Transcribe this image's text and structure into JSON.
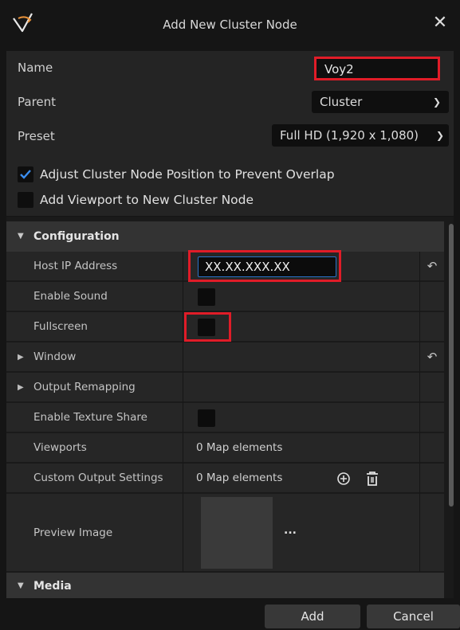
{
  "window": {
    "title": "Add New Cluster Node",
    "close_icon": "close-icon",
    "logo_icon": "app-logo-icon"
  },
  "form": {
    "name_label": "Name",
    "name_value": "Voy2",
    "parent_label": "Parent",
    "parent_value": "Cluster",
    "preset_label": "Preset",
    "preset_value": "Full HD (1,920 x 1,080)",
    "adjust_position": {
      "label": "Adjust Cluster Node Position to Prevent Overlap",
      "checked": true
    },
    "add_viewport": {
      "label": "Add Viewport to New Cluster Node",
      "checked": false
    }
  },
  "details": {
    "configuration_label": "Configuration",
    "host_ip_label": "Host IP Address",
    "host_ip_value": "XX.XX.XXX.XX",
    "enable_sound_label": "Enable Sound",
    "enable_sound_checked": false,
    "fullscreen_label": "Fullscreen",
    "fullscreen_checked": false,
    "window_label": "Window",
    "output_remapping_label": "Output Remapping",
    "enable_texture_share_label": "Enable Texture Share",
    "enable_texture_share_checked": false,
    "viewports_label": "Viewports",
    "viewports_value": "0 Map elements",
    "custom_output_label": "Custom Output Settings",
    "custom_output_value": "0 Map elements",
    "preview_image_label": "Preview Image",
    "preview_more": "...",
    "media_label": "Media"
  },
  "buttons": {
    "add": "Add",
    "cancel": "Cancel"
  },
  "colors": {
    "highlight_red": "#e01c28",
    "accent_blue": "#2a73c9",
    "background": "#151515"
  }
}
